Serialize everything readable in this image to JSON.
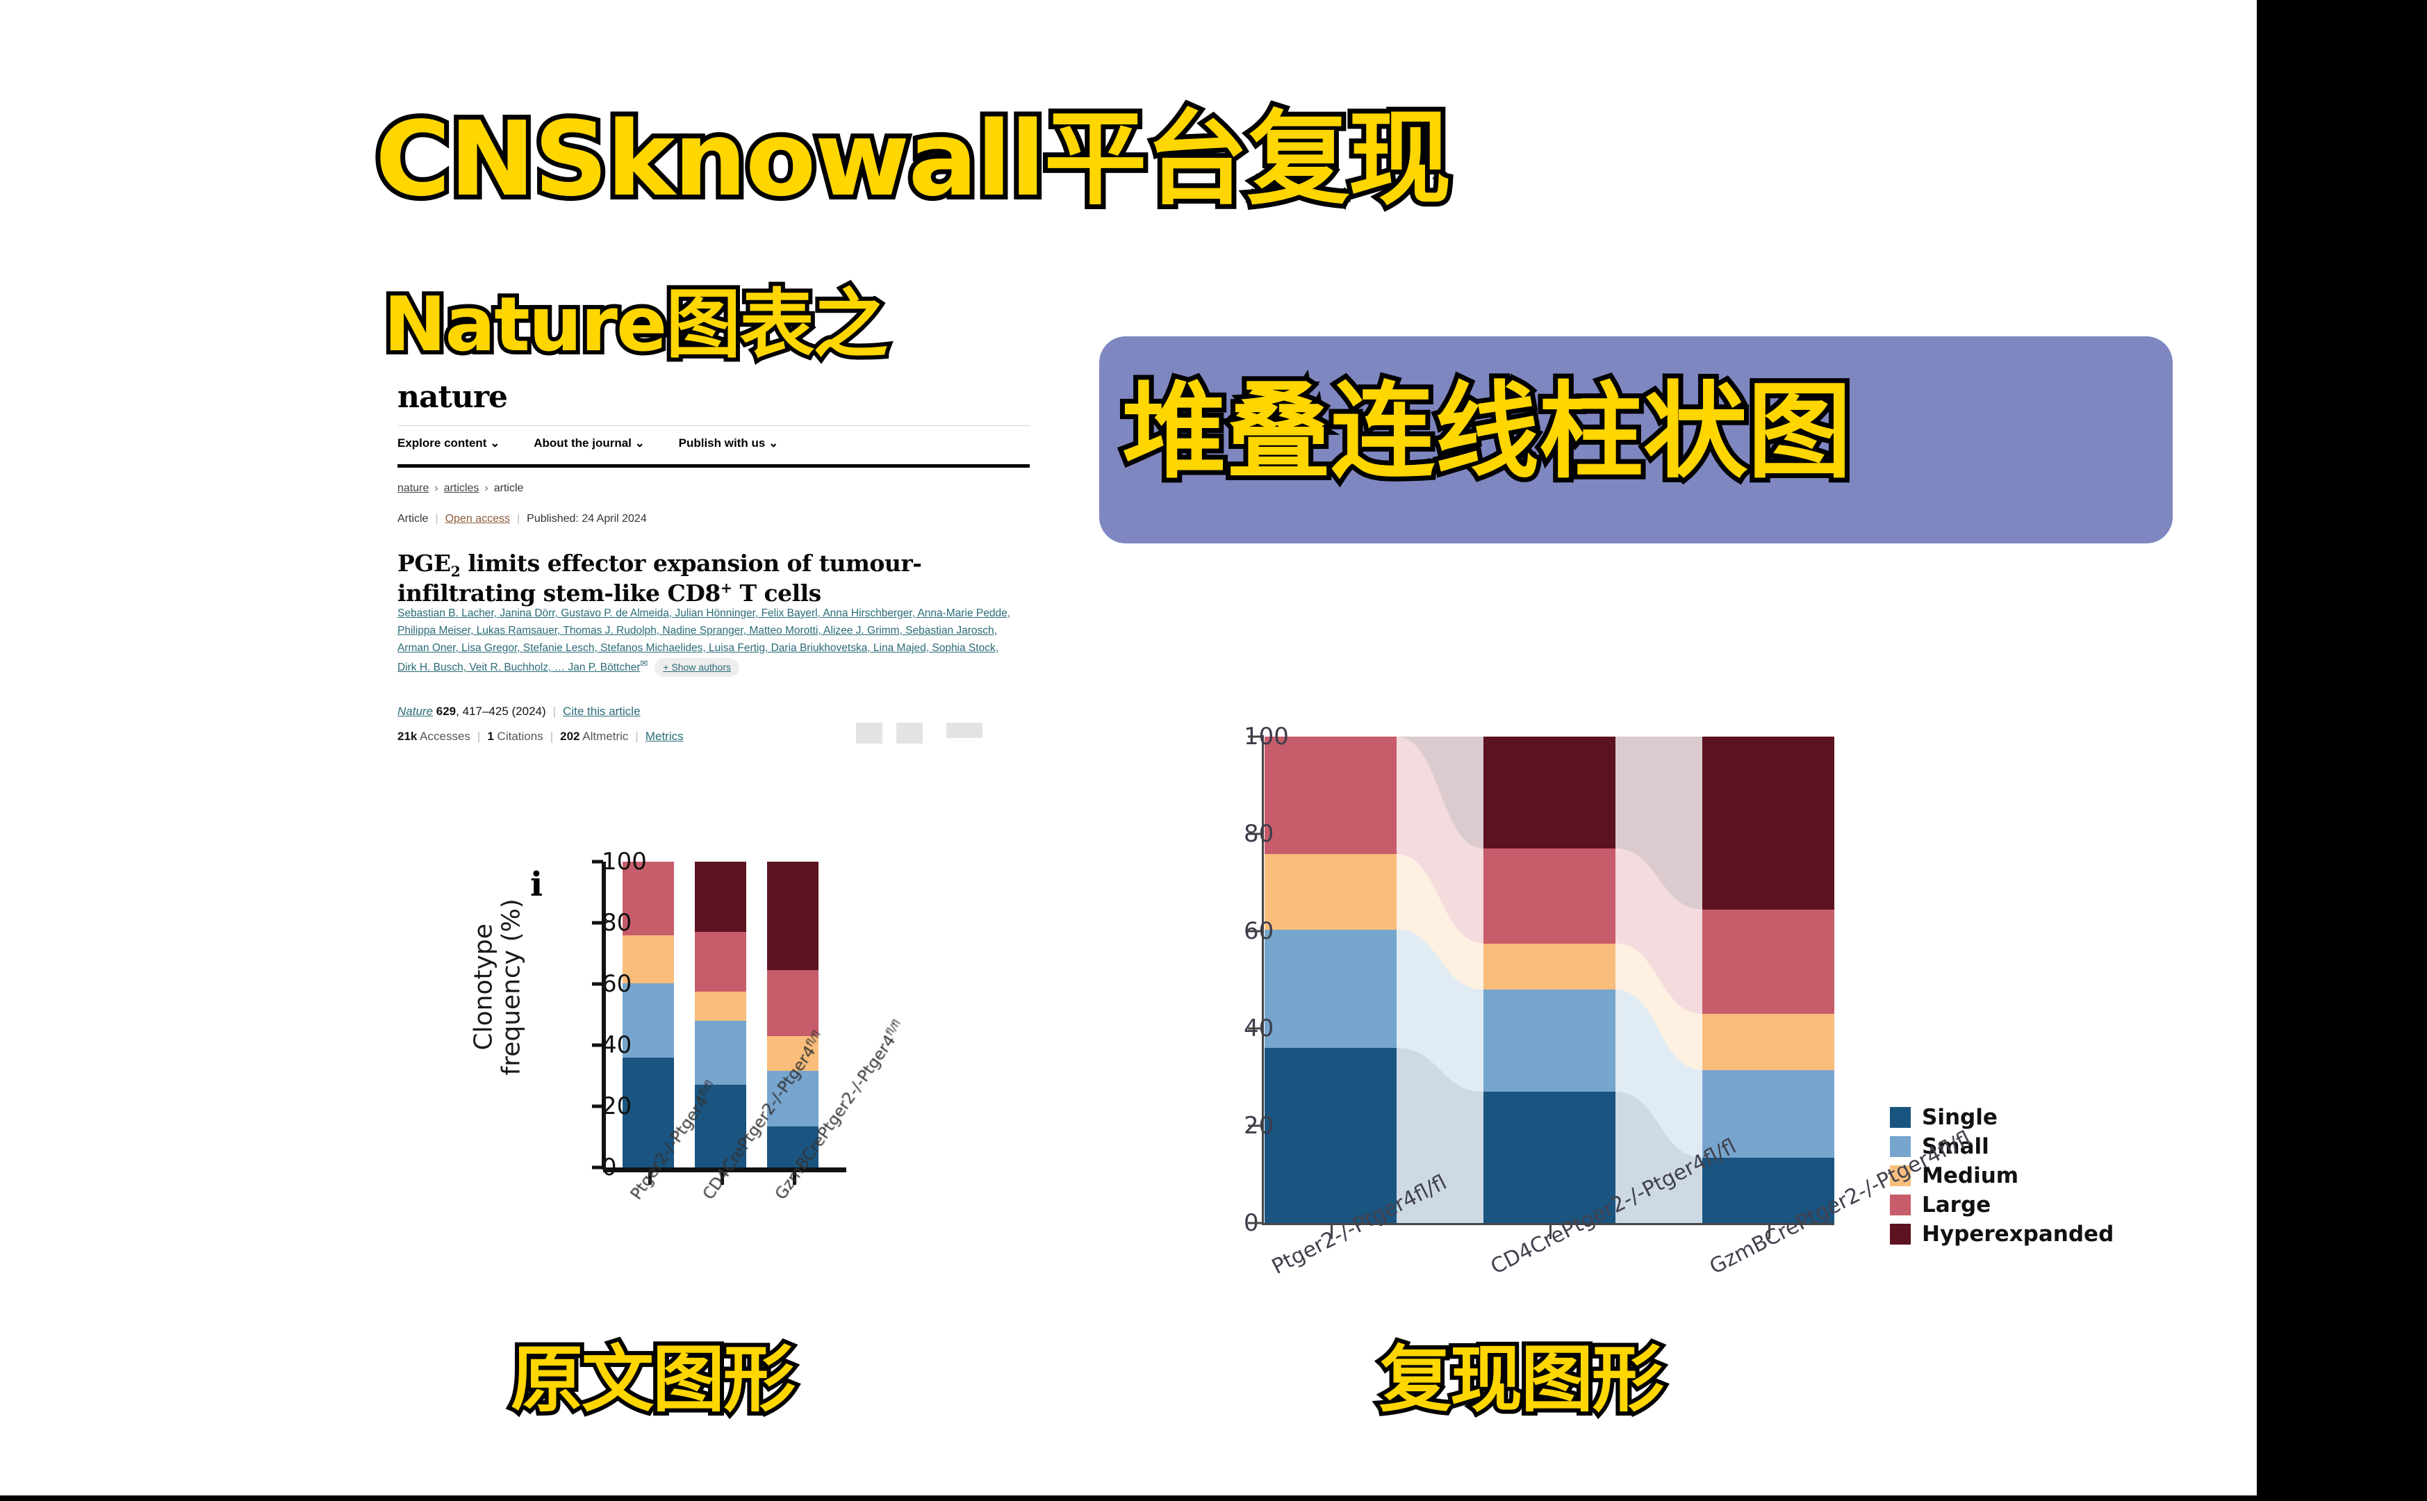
{
  "titles": {
    "main": "CNSknowall平台复现",
    "sub": "Nature图表之",
    "highlight_box": "堆叠连线柱状图",
    "caption_left": "原文图形",
    "caption_right": "复现图形"
  },
  "colors": {
    "title_fill": "#FFD600",
    "title_stroke": "#000000",
    "highlight_box_bg": "#7F87C0",
    "single": "#1A5480",
    "small": "#76A5CE",
    "medium": "#F9BE7C",
    "large": "#C75C6A",
    "hyperexpanded": "#5C1220"
  },
  "nature_article": {
    "logo": "nature",
    "nav": [
      {
        "label": "Explore content",
        "caret": "⌄"
      },
      {
        "label": "About the journal",
        "caret": "⌄"
      },
      {
        "label": "Publish with us",
        "caret": "⌄"
      }
    ],
    "breadcrumb": [
      "nature",
      "articles",
      "article"
    ],
    "breadcrumb_separator": "›",
    "meta": {
      "type": "Article",
      "access": "Open access",
      "published": "Published: 24 April 2024"
    },
    "title_parts": {
      "a": "PGE",
      "sub1": "2",
      "b": " limits effector expansion of tumour-infiltrating stem-like CD8",
      "sup1": "+",
      "c": " T cells"
    },
    "authors": "Sebastian B. Lacher, Janina Dörr, Gustavo P. de Almeida, Julian Hönninger, Felix Bayerl, Anna Hirschberger, Anna-Marie Pedde, Philippa Meiser, Lukas Ramsauer, Thomas J. Rudolph, Nadine Spranger, Matteo Morotti, Alizee J. Grimm, Sebastian Jarosch, Arman Oner, Lisa Gregor, Stefanie Lesch, Stefanos Michaelides, Luisa Fertig, Daria Briukhovetska, Lina Majed, Sophia Stock, Dirk H. Busch, Veit R. Buchholz, … Jan P. Böttcher",
    "envelope_icon": "✉",
    "show_authors": "+ Show authors",
    "citation": {
      "journal": "Nature",
      "volume": "629",
      "pages": "417–425 (2024)",
      "cite_link": "Cite this article"
    },
    "metrics": {
      "accesses_value": "21k",
      "accesses_label": "Accesses",
      "citations_value": "1",
      "citations_label": "Citations",
      "altmetric_value": "202",
      "altmetric_label": "Altmetric",
      "metrics_link": "Metrics"
    }
  },
  "original_figure": {
    "panel_letter": "i",
    "ylabel_line1": "Clonotype",
    "ylabel_line2": "frequency (%)"
  },
  "chart_data": {
    "type": "bar",
    "subtype": "stacked-percentage-with-alluvial-ribbons",
    "title": "",
    "xlabel": "",
    "ylabel": "Clonotype frequency (%)",
    "ylim": [
      0,
      100
    ],
    "yticks": [
      0,
      20,
      40,
      60,
      80,
      100
    ],
    "grid": false,
    "legend_position": "right",
    "categories": [
      "Ptger2-/-Ptger4fl/fl",
      "CD4CrePtger2-/-Ptger4fl/fl",
      "GzmBCrePtger2-/-Ptger4fl/fl"
    ],
    "series": [
      {
        "name": "Single",
        "color": "#1A5480",
        "values": [
          36.0,
          27.0,
          13.5
        ]
      },
      {
        "name": "Small",
        "color": "#76A5CE",
        "values": [
          24.3,
          21.0,
          18.0
        ]
      },
      {
        "name": "Medium",
        "color": "#F9BE7C",
        "values": [
          15.5,
          9.5,
          11.5
        ]
      },
      {
        "name": "Large",
        "color": "#C75C6A",
        "values": [
          24.2,
          19.5,
          21.5
        ]
      },
      {
        "name": "Hyperexpanded",
        "color": "#5C1220",
        "values": [
          0.0,
          23.0,
          35.5
        ]
      }
    ]
  }
}
